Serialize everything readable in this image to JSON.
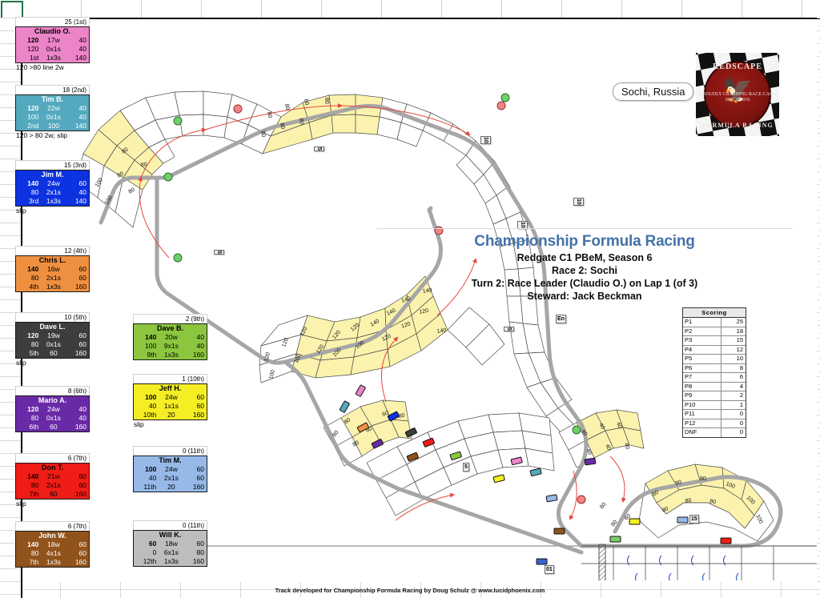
{
  "location": {
    "label": "Sochi, Russia"
  },
  "logo": {
    "top_text": "REDSCAPE",
    "bottom_text": "FORMULA RACING",
    "center_text": "PROUDLY CRASHING RACE CARS SINCE 2016",
    "eagle_icon": "double-headed-eagle"
  },
  "title": {
    "line1": "Championship Formula Racing",
    "line2": "Redgate C1 PBeM, Season 6",
    "line3": "Race 2: Sochi",
    "line4": "Turn 2: Race Leader (Claudio O.) on Lap 1 (of 3)",
    "line5": "Steward: Jack Beckman",
    "accent_color": "#4472a8"
  },
  "scoring": {
    "header": "Scoring",
    "rows": [
      {
        "pos": "P1",
        "pts": "25"
      },
      {
        "pos": "P2",
        "pts": "18"
      },
      {
        "pos": "P3",
        "pts": "15"
      },
      {
        "pos": "P4",
        "pts": "12"
      },
      {
        "pos": "P5",
        "pts": "10"
      },
      {
        "pos": "P6",
        "pts": "8"
      },
      {
        "pos": "P7",
        "pts": "6"
      },
      {
        "pos": "P8",
        "pts": "4"
      },
      {
        "pos": "P9",
        "pts": "2"
      },
      {
        "pos": "P10",
        "pts": "1"
      },
      {
        "pos": "P11",
        "pts": "0"
      },
      {
        "pos": "P12",
        "pts": "0"
      },
      {
        "pos": "DNF",
        "pts": "0"
      }
    ]
  },
  "drivers": [
    {
      "header": "25 (1st)",
      "name": "Claudio O.",
      "color": "#ec84c8",
      "text_color": "#000000",
      "r1": [
        "120",
        "17w",
        "40"
      ],
      "r2": [
        "120",
        "0x1s",
        "40"
      ],
      "r3": [
        "1st",
        "1x3s",
        "140"
      ],
      "note": "120 >80 line 2w"
    },
    {
      "header": "18 (2nd)",
      "name": "Tim B.",
      "color": "#54a9bf",
      "text_color": "#ffffff",
      "r1": [
        "120",
        "22w",
        "40"
      ],
      "r2": [
        "100",
        "0x1s",
        "40"
      ],
      "r3": [
        "2nd",
        "100",
        "140"
      ],
      "note": "120 > 80 2w; slip"
    },
    {
      "header": "15 (3rd)",
      "name": "Jim M.",
      "color": "#0d32e0",
      "text_color": "#ffffff",
      "r1": [
        "140",
        "24w",
        "60"
      ],
      "r2": [
        "80",
        "2x1s",
        "40"
      ],
      "r3": [
        "3rd",
        "1x3s",
        "140"
      ],
      "note": "slip"
    },
    {
      "header": "12 (4th)",
      "name": "Chris L.",
      "color": "#ef9040",
      "text_color": "#000000",
      "r1": [
        "140",
        "16w",
        "60"
      ],
      "r2": [
        "80",
        "2x1s",
        "60"
      ],
      "r3": [
        "4th",
        "1x3s",
        "160"
      ],
      "note": ""
    },
    {
      "header": "10 (5th)",
      "name": "Dave L.",
      "color": "#3d3d3d",
      "text_color": "#ffffff",
      "r1": [
        "120",
        "19w",
        "60"
      ],
      "r2": [
        "80",
        "0x1s",
        "60"
      ],
      "r3": [
        "5th",
        "60",
        "160"
      ],
      "note": "slip"
    },
    {
      "header": "8 (6th)",
      "name": "Mario A.",
      "color": "#6a2aa8",
      "text_color": "#ffffff",
      "r1": [
        "120",
        "24w",
        "40"
      ],
      "r2": [
        "80",
        "0x1s",
        "40"
      ],
      "r3": [
        "6th",
        "60",
        "160"
      ],
      "note": ""
    },
    {
      "header": "6 (7th)",
      "name": "Don T.",
      "color": "#f01d16",
      "text_color": "#000000",
      "r1": [
        "140",
        "21w",
        "60"
      ],
      "r2": [
        "80",
        "2x1s",
        "60"
      ],
      "r3": [
        "7th",
        "60",
        "160"
      ],
      "note": "slip"
    },
    {
      "header": "6 (7th)",
      "name": "John W.",
      "color": "#91531c",
      "text_color": "#ffffff",
      "r1": [
        "140",
        "18w",
        "60"
      ],
      "r2": [
        "80",
        "4x1s",
        "60"
      ],
      "r3": [
        "7th",
        "1x3s",
        "160"
      ],
      "note": ""
    }
  ],
  "drivers_col2": [
    {
      "header": "2 (9th)",
      "name": "Dave B.",
      "color": "#8cc63e",
      "text_color": "#000000",
      "r1": [
        "140",
        "20w",
        "40"
      ],
      "r2": [
        "100",
        "9x1s",
        "40"
      ],
      "r3": [
        "9th",
        "1x3s",
        "160"
      ],
      "note": ""
    },
    {
      "header": "1 (10th)",
      "name": "Jeff H.",
      "color": "#f5ee24",
      "text_color": "#000000",
      "r1": [
        "100",
        "24w",
        "60"
      ],
      "r2": [
        "40",
        "1x1s",
        "60"
      ],
      "r3": [
        "10th",
        "20",
        "160"
      ],
      "note": "slip"
    },
    {
      "header": "0 (11th)",
      "name": "Tim M.",
      "color": "#96b9e8",
      "text_color": "#000000",
      "r1": [
        "100",
        "24w",
        "60"
      ],
      "r2": [
        "40",
        "2x1s",
        "60"
      ],
      "r3": [
        "11th",
        "20",
        "160"
      ],
      "note": ""
    },
    {
      "header": "0 (11th)",
      "name": "Will K.",
      "color": "#bdbdbd",
      "text_color": "#000000",
      "r1": [
        "60",
        "18w",
        "60"
      ],
      "r2": [
        "0",
        "6x1s",
        "80"
      ],
      "r3": [
        "12th",
        "1x3s",
        "160"
      ],
      "note": ""
    }
  ],
  "track": {
    "corner_speeds": [
      "40",
      "60",
      "80",
      "100",
      "120",
      "140"
    ],
    "distance_markers": [
      "5",
      "10",
      "15",
      "01"
    ],
    "start_finish": "start-finish-line",
    "car_colors": [
      "#ec84c8",
      "#54a9bf",
      "#0d32e0",
      "#ef9040",
      "#3d3d3d",
      "#6a2aa8",
      "#f01d16",
      "#91531c",
      "#8cc63e",
      "#f5ee24",
      "#96b9e8",
      "#bdbdbd"
    ]
  },
  "footer": {
    "text": "Track developed for Championship Formula Racing by Doug Schulz @ www.lucidphoenix.com"
  }
}
